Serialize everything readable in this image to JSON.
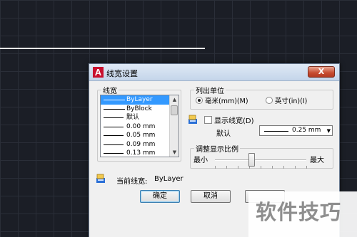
{
  "dialog": {
    "title": "线宽设置",
    "close_label": "X"
  },
  "lineweights": {
    "legend": "线宽",
    "items": [
      {
        "label": "ByLayer",
        "selected": true
      },
      {
        "label": "ByBlock",
        "selected": false
      },
      {
        "label": "默认",
        "selected": false
      },
      {
        "label": "0.00 mm",
        "selected": false
      },
      {
        "label": "0.05 mm",
        "selected": false
      },
      {
        "label": "0.09 mm",
        "selected": false
      },
      {
        "label": "0.13 mm",
        "selected": false
      }
    ]
  },
  "units": {
    "legend": "列出单位",
    "mm_label": "毫米(mm)(M)",
    "inch_label": "英寸(in)(I)",
    "selected": "mm"
  },
  "display": {
    "show_lineweight_label": "显示线宽(D)",
    "show_lineweight_checked": false,
    "default_label": "默认",
    "default_value": "0.25 mm"
  },
  "scale": {
    "legend": "调整显示比例",
    "min_label": "最小",
    "max_label": "最大",
    "position_fraction": 0.4
  },
  "current": {
    "label": "当前线宽:",
    "value": "ByLayer"
  },
  "buttons": {
    "ok": "确定",
    "cancel": "取消"
  },
  "watermark": {
    "text": "软件技巧"
  },
  "colors": {
    "selection": "#3399ff",
    "close_button": "#c74b30",
    "app_icon": "#c8102e"
  },
  "icons": [
    "autocad-app-icon",
    "close-icon",
    "lineweight-icon",
    "scroll-up-icon",
    "scroll-down-icon",
    "dropdown-arrow-icon"
  ]
}
